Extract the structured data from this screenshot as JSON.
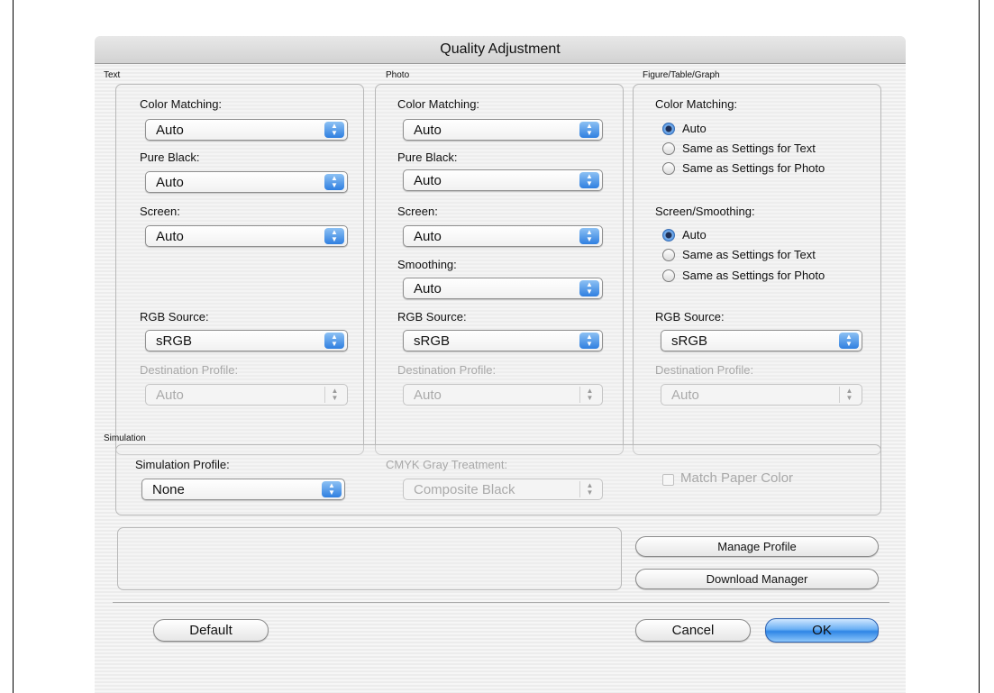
{
  "window": {
    "title": "Quality Adjustment"
  },
  "text_group": {
    "label": "Text",
    "color_matching": {
      "label": "Color Matching:",
      "value": "Auto"
    },
    "pure_black": {
      "label": "Pure Black:",
      "value": "Auto"
    },
    "screen": {
      "label": "Screen:",
      "value": "Auto"
    },
    "rgb_source": {
      "label": "RGB Source:",
      "value": "sRGB"
    },
    "destination_profile": {
      "label": "Destination Profile:",
      "value": "Auto",
      "enabled": false
    }
  },
  "photo_group": {
    "label": "Photo",
    "color_matching": {
      "label": "Color Matching:",
      "value": "Auto"
    },
    "pure_black": {
      "label": "Pure Black:",
      "value": "Auto"
    },
    "screen": {
      "label": "Screen:",
      "value": "Auto"
    },
    "smoothing": {
      "label": "Smoothing:",
      "value": "Auto"
    },
    "rgb_source": {
      "label": "RGB Source:",
      "value": "sRGB"
    },
    "destination_profile": {
      "label": "Destination Profile:",
      "value": "Auto",
      "enabled": false
    }
  },
  "figure_group": {
    "label": "Figure/Table/Graph",
    "color_matching": {
      "label": "Color Matching:",
      "options": [
        "Auto",
        "Same as Settings for Text",
        "Same as Settings for Photo"
      ],
      "selected": "Auto"
    },
    "screen_smoothing": {
      "label": "Screen/Smoothing:",
      "options": [
        "Auto",
        "Same as Settings for Text",
        "Same as Settings for Photo"
      ],
      "selected": "Auto"
    },
    "rgb_source": {
      "label": "RGB Source:",
      "value": "sRGB"
    },
    "destination_profile": {
      "label": "Destination Profile:",
      "value": "Auto",
      "enabled": false
    }
  },
  "simulation_group": {
    "label": "Simulation",
    "simulation_profile": {
      "label": "Simulation Profile:",
      "value": "None"
    },
    "cmyk_gray_treatment": {
      "label": "CMYK Gray Treatment:",
      "value": "Composite Black",
      "enabled": false
    },
    "match_paper_color": {
      "label": "Match Paper Color",
      "checked": false,
      "enabled": false
    }
  },
  "buttons": {
    "manage_profile": "Manage Profile",
    "download_manager": "Download Manager",
    "default": "Default",
    "cancel": "Cancel",
    "ok": "OK"
  },
  "colors": {
    "accent_blue": "#2f86e6",
    "disabled_text": "#a8a8a8"
  },
  "icons": {
    "popup_arrows": "up-down-arrows-icon",
    "radio_selected": "radio-selected-icon",
    "radio_unselected": "radio-unselected-icon"
  }
}
